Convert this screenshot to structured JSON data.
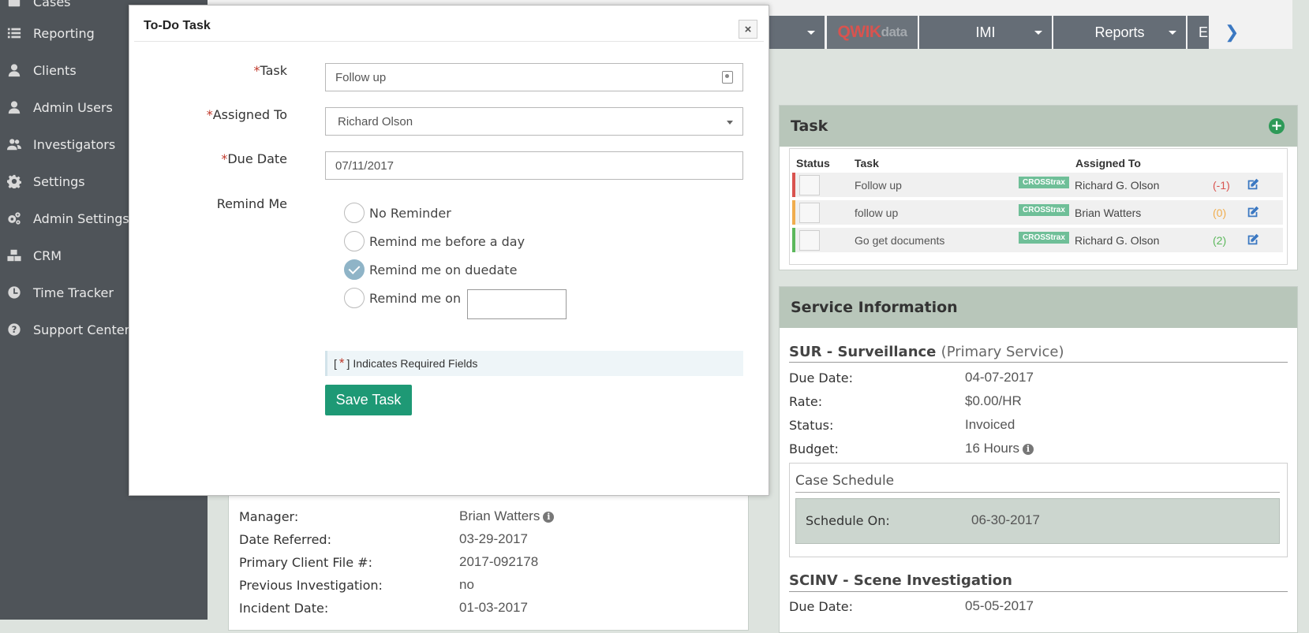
{
  "sidebar": {
    "items": [
      {
        "label": "Cases",
        "icon": "briefcase-icon"
      },
      {
        "label": "Reporting",
        "icon": "list-icon"
      },
      {
        "label": "Clients",
        "icon": "user-icon"
      },
      {
        "label": "Admin Users",
        "icon": "user-icon"
      },
      {
        "label": "Investigators",
        "icon": "users-icon"
      },
      {
        "label": "Settings",
        "icon": "gear-icon"
      },
      {
        "label": "Admin Settings",
        "icon": "gears-icon"
      },
      {
        "label": "CRM",
        "icon": "cubes-icon"
      },
      {
        "label": "Time Tracker",
        "icon": "clock-icon"
      },
      {
        "label": "Support Center",
        "icon": "question-icon"
      }
    ]
  },
  "topnav": {
    "qwik_1": "QWIK",
    "qwik_2": "data",
    "imi": "IMI",
    "reports": "Reports",
    "more": "E"
  },
  "task_panel": {
    "title": "Task",
    "headers": {
      "status": "Status",
      "task": "Task",
      "assigned": "Assigned To"
    },
    "rows": [
      {
        "task": "Follow up",
        "badge": "CROSStrax",
        "assignee": "Richard G. Olson",
        "count": "(-1)",
        "color": "#d9534f"
      },
      {
        "task": "follow up",
        "badge": "CROSStrax",
        "assignee": "Brian Watters",
        "count": "(0)",
        "color": "#f0ad4e"
      },
      {
        "task": "Go get documents",
        "badge": "CROSStrax",
        "assignee": "Richard G. Olson",
        "count": "(2)",
        "color": "#5cb85c"
      }
    ]
  },
  "service_panel": {
    "title": "Service Information",
    "service1": {
      "code": "SUR - Surveillance",
      "note": "(Primary Service)",
      "due_label": "Due Date:",
      "due": "04-07-2017",
      "rate_label": "Rate:",
      "rate": "$0.00/HR",
      "status_label": "Status:",
      "status": "Invoiced",
      "budget_label": "Budget:",
      "budget": "16 Hours"
    },
    "schedule": {
      "title": "Case Schedule",
      "label": "Schedule On:",
      "value": "06-30-2017"
    },
    "service2": {
      "code": "SCINV - Scene Investigation",
      "due_label": "Due Date:",
      "due": "05-05-2017"
    }
  },
  "case_details": {
    "manager_label": "Manager:",
    "manager": "Brian Watters",
    "referred_label": "Date Referred:",
    "referred": "03-29-2017",
    "file_label": "Primary Client File #:",
    "file": "2017-092178",
    "prev_label": "Previous Investigation:",
    "prev": "no",
    "incident_label": "Incident Date:",
    "incident": "01-03-2017"
  },
  "modal": {
    "title": "To-Do Task",
    "close": "×",
    "task_label": "Task",
    "task_value": "Follow up",
    "assigned_label": "Assigned To",
    "assigned_value": "Richard Olson",
    "due_label": "Due Date",
    "due_value": "07/11/2017",
    "remind_label": "Remind Me",
    "reminders": [
      {
        "label": "No Reminder",
        "checked": false
      },
      {
        "label": "Remind me before a day",
        "checked": false
      },
      {
        "label": "Remind me on duedate",
        "checked": true
      },
      {
        "label": "Remind me on",
        "checked": false
      }
    ],
    "required_open": "[",
    "required_star": "*",
    "required_close": "]",
    "required_text": "Indicates Required Fields",
    "save_label": "Save Task"
  },
  "colors": {
    "accent": "#1e9975",
    "nav": "#656d76",
    "panel_head": "#b8c6ba",
    "sidebar": "#4f5459"
  }
}
